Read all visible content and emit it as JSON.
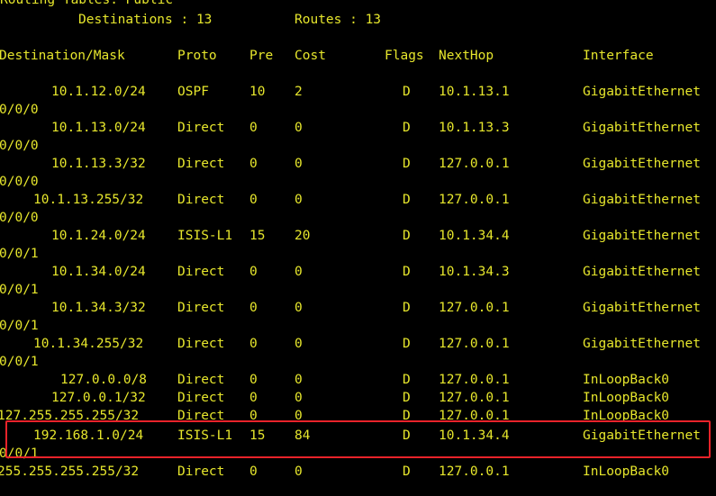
{
  "header": {
    "table_title": "Routing Tables: Public",
    "destinations_text": "Destinations : 13",
    "routes_text": "Routes : 13"
  },
  "columns": {
    "destination": "Destination/Mask",
    "proto": "Proto",
    "pre": "Pre",
    "cost": "Cost",
    "flags": "Flags",
    "nexthop": "NextHop",
    "interface": "Interface"
  },
  "routes": [
    {
      "dest": "10.1.12.0/24",
      "proto": "OSPF",
      "pre": "10",
      "cost": "2",
      "flags": "D",
      "nexthop": "10.1.13.1",
      "iface": "GigabitEthernet",
      "iface_cont": "0/0/0"
    },
    {
      "dest": "10.1.13.0/24",
      "proto": "Direct",
      "pre": "0",
      "cost": "0",
      "flags": "D",
      "nexthop": "10.1.13.3",
      "iface": "GigabitEthernet",
      "iface_cont": "0/0/0"
    },
    {
      "dest": "10.1.13.3/32",
      "proto": "Direct",
      "pre": "0",
      "cost": "0",
      "flags": "D",
      "nexthop": "127.0.0.1",
      "iface": "GigabitEthernet",
      "iface_cont": "0/0/0"
    },
    {
      "dest": "10.1.13.255/32",
      "proto": "Direct",
      "pre": "0",
      "cost": "0",
      "flags": "D",
      "nexthop": "127.0.0.1",
      "iface": "GigabitEthernet",
      "iface_cont": "0/0/0"
    },
    {
      "dest": "10.1.24.0/24",
      "proto": "ISIS-L1",
      "pre": "15",
      "cost": "20",
      "flags": "D",
      "nexthop": "10.1.34.4",
      "iface": "GigabitEthernet",
      "iface_cont": "0/0/1"
    },
    {
      "dest": "10.1.34.0/24",
      "proto": "Direct",
      "pre": "0",
      "cost": "0",
      "flags": "D",
      "nexthop": "10.1.34.3",
      "iface": "GigabitEthernet",
      "iface_cont": "0/0/1"
    },
    {
      "dest": "10.1.34.3/32",
      "proto": "Direct",
      "pre": "0",
      "cost": "0",
      "flags": "D",
      "nexthop": "127.0.0.1",
      "iface": "GigabitEthernet",
      "iface_cont": "0/0/1"
    },
    {
      "dest": "10.1.34.255/32",
      "proto": "Direct",
      "pre": "0",
      "cost": "0",
      "flags": "D",
      "nexthop": "127.0.0.1",
      "iface": "GigabitEthernet",
      "iface_cont": "0/0/1"
    },
    {
      "dest": "127.0.0.0/8",
      "proto": "Direct",
      "pre": "0",
      "cost": "0",
      "flags": "D",
      "nexthop": "127.0.0.1",
      "iface": "InLoopBack0",
      "iface_cont": ""
    },
    {
      "dest": "127.0.0.1/32",
      "proto": "Direct",
      "pre": "0",
      "cost": "0",
      "flags": "D",
      "nexthop": "127.0.0.1",
      "iface": "InLoopBack0",
      "iface_cont": ""
    },
    {
      "dest": "127.255.255.255/32",
      "proto": "Direct",
      "pre": "0",
      "cost": "0",
      "flags": "D",
      "nexthop": "127.0.0.1",
      "iface": "InLoopBack0",
      "iface_cont": ""
    },
    {
      "dest": "192.168.1.0/24",
      "proto": "ISIS-L1",
      "pre": "15",
      "cost": "84",
      "flags": "D",
      "nexthop": "10.1.34.4",
      "iface": "GigabitEthernet",
      "iface_cont": "0/0/1"
    },
    {
      "dest": "255.255.255.255/32",
      "proto": "Direct",
      "pre": "0",
      "cost": "0",
      "flags": "D",
      "nexthop": "127.0.0.1",
      "iface": "InLoopBack0",
      "iface_cont": ""
    }
  ],
  "highlighted_route_index": 11,
  "colors": {
    "background": "#000000",
    "text": "#e6e62c",
    "highlight": "#e8232a"
  }
}
